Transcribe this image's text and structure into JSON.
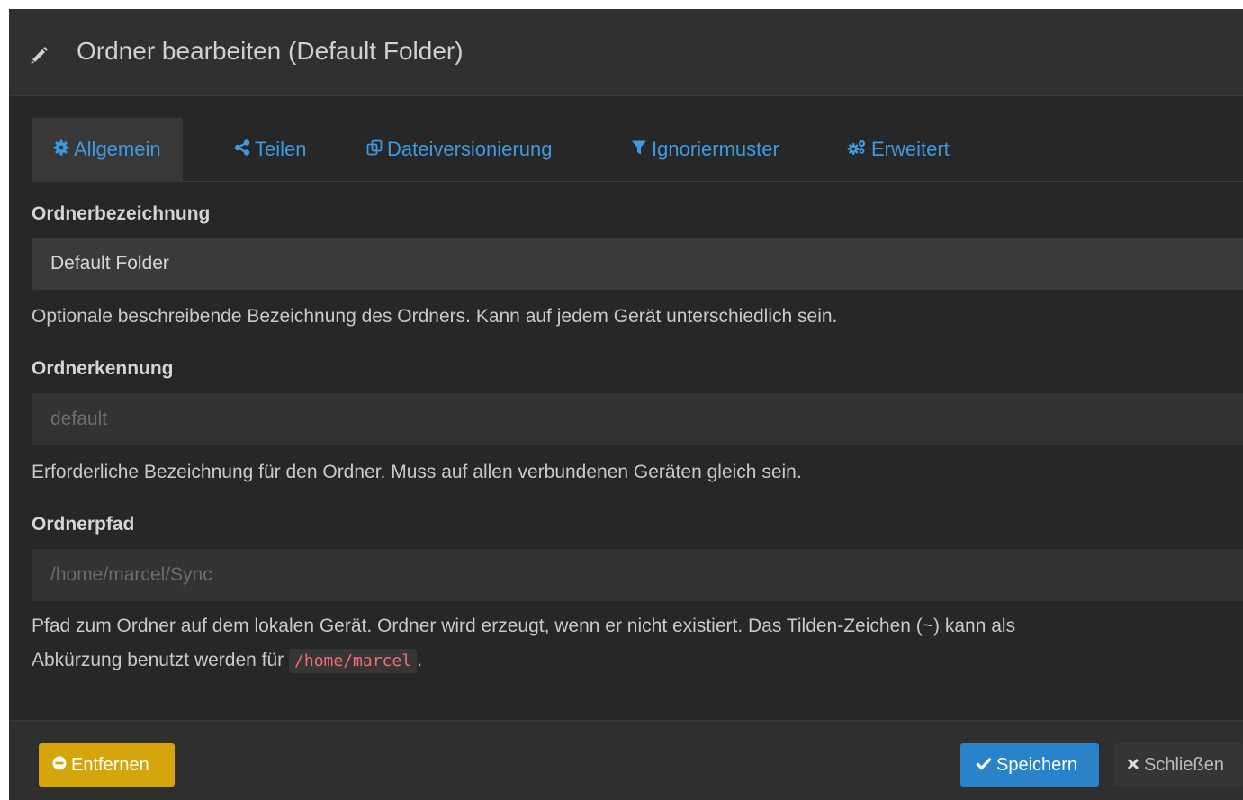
{
  "dialog": {
    "title": "Ordner bearbeiten (Default Folder)"
  },
  "tabs": [
    {
      "label": "Allgemein",
      "icon": "gear-icon",
      "active": true
    },
    {
      "label": "Teilen",
      "icon": "share-icon",
      "active": false
    },
    {
      "label": "Dateiversionierung",
      "icon": "copy-icon",
      "active": false
    },
    {
      "label": "Ignoriermuster",
      "icon": "filter-icon",
      "active": false
    },
    {
      "label": "Erweitert",
      "icon": "gears-icon",
      "active": false
    }
  ],
  "form": {
    "label_field": {
      "label": "Ordnerbezeichnung",
      "value": "Default Folder",
      "help": "Optionale beschreibende Bezeichnung des Ordners. Kann auf jedem Gerät unterschiedlich sein."
    },
    "id_field": {
      "label": "Ordnerkennung",
      "value": "default",
      "help": "Erforderliche Bezeichnung für den Ordner. Muss auf allen verbundenen Geräten gleich sein."
    },
    "path_field": {
      "label": "Ordnerpfad",
      "value": "/home/marcel/Sync",
      "help_line1": "Pfad zum Ordner auf dem lokalen Gerät. Ordner wird erzeugt, wenn er nicht existiert. Das Tilden-Zeichen (~) kann als",
      "help_line2_prefix": "Abkürzung benutzt werden für",
      "help_code": "/home/marcel",
      "help_line2_suffix": "."
    }
  },
  "footer": {
    "remove_label": "Entfernen",
    "save_label": "Speichern",
    "close_label": "Schließen"
  },
  "colors": {
    "accent": "#3d9ae0",
    "warning": "#d4a60c",
    "primary": "#2a83c9"
  }
}
